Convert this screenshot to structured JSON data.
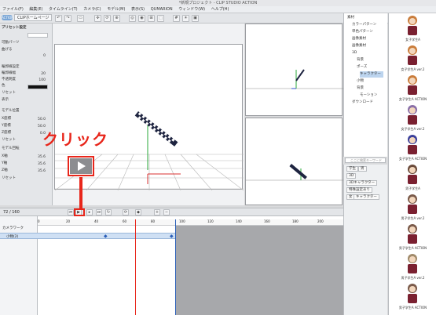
{
  "window": {
    "title": "*新規プロジェクト - CLIP STUDIO ACTION"
  },
  "menu": [
    "ファイル(F)",
    "編集(E)",
    "タイムライン(T)",
    "カメラ(C)",
    "モデル(M)",
    "表示(S)",
    "QUMARION",
    "ウィンドウ(W)",
    "ヘルプ(H)"
  ],
  "tabs": {
    "home": "ACTION",
    "homepage": "CLIPホームページ"
  },
  "left_panel": {
    "header": "プリセット設定",
    "rows": [
      {
        "label": "可動パーツ",
        "value": ""
      },
      {
        "label": "曲げる",
        "value": "0"
      },
      {
        "label": "輪郭線設定",
        "value": ""
      },
      {
        "label": "輪郭線幅",
        "value": "20"
      },
      {
        "label": "不透明度",
        "value": "100"
      },
      {
        "label": "色",
        "value": ""
      },
      {
        "label": "リセット",
        "value": ""
      },
      {
        "label": "表示",
        "value": ""
      },
      {
        "label": "モデル位置",
        "value": ""
      },
      {
        "label": "X座標",
        "value": "50.0"
      },
      {
        "label": "Y座標",
        "value": "50.0"
      },
      {
        "label": "Z座標",
        "value": "0.0"
      },
      {
        "label": "リセット",
        "value": ""
      },
      {
        "label": "モデル回転",
        "value": ""
      },
      {
        "label": "X軸",
        "value": "35.6"
      },
      {
        "label": "Y軸",
        "value": "35.6"
      },
      {
        "label": "Z軸",
        "value": "35.6"
      },
      {
        "label": "リセット",
        "value": ""
      }
    ]
  },
  "material_tree": {
    "items": [
      {
        "label": "素材",
        "indent": 0
      },
      {
        "label": "カラーパターン",
        "indent": 1
      },
      {
        "label": "単色パターン",
        "indent": 1
      },
      {
        "label": "画像素材",
        "indent": 1
      },
      {
        "label": "画像素材",
        "indent": 1
      },
      {
        "label": "3D",
        "indent": 1
      },
      {
        "label": "背景",
        "indent": 2
      },
      {
        "label": "ポーズ",
        "indent": 2
      },
      {
        "label": "キャラクター",
        "indent": 3
      },
      {
        "label": "小物",
        "indent": 2
      },
      {
        "label": "背景",
        "indent": 2
      },
      {
        "label": "モーション",
        "indent": 3
      },
      {
        "label": "ダウンロード",
        "indent": 1
      }
    ],
    "search_placeholder": "ここに検索キーワード"
  },
  "tags": [
    "学生",
    "男",
    "3D",
    "3Dキャラクター",
    "特殊設定あり",
    "女",
    "キャラクター"
  ],
  "characters": [
    {
      "label": "女子学生A"
    },
    {
      "label": "女子学生A ver.2"
    },
    {
      "label": "女子学生A ACTION"
    },
    {
      "label": "女子学生A ver.2"
    },
    {
      "label": "女子学生A ACTION"
    },
    {
      "label": "男子学生A"
    },
    {
      "label": "男子学生A ver.2"
    },
    {
      "label": "男子学生A ACTION"
    },
    {
      "label": "男子学生A ver.2"
    },
    {
      "label": "男子学生A ACTION"
    }
  ],
  "timeline": {
    "frame_readout": "72 / 160",
    "ruler_ticks": [
      "0",
      "20",
      "40",
      "60",
      "80",
      "100",
      "120",
      "140",
      "160",
      "180",
      "200",
      "220"
    ],
    "tracks": [
      {
        "label": "カメラワーク"
      },
      {
        "label": "小物(2)"
      }
    ]
  },
  "annotation": {
    "text": "クリック"
  },
  "colors": {
    "annotation_red": "#e8261b",
    "track_blue": "#cfe0f4",
    "accent": "#7aa6d6"
  }
}
